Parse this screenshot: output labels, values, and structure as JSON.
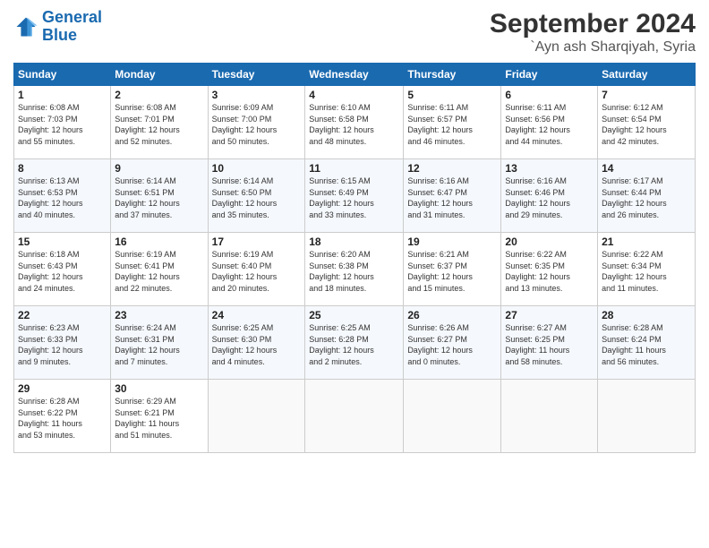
{
  "logo": {
    "line1": "General",
    "line2": "Blue"
  },
  "title": "September 2024",
  "subtitle": "`Ayn ash Sharqiyah, Syria",
  "header_days": [
    "Sunday",
    "Monday",
    "Tuesday",
    "Wednesday",
    "Thursday",
    "Friday",
    "Saturday"
  ],
  "weeks": [
    [
      {
        "day": "1",
        "info": "Sunrise: 6:08 AM\nSunset: 7:03 PM\nDaylight: 12 hours\nand 55 minutes."
      },
      {
        "day": "2",
        "info": "Sunrise: 6:08 AM\nSunset: 7:01 PM\nDaylight: 12 hours\nand 52 minutes."
      },
      {
        "day": "3",
        "info": "Sunrise: 6:09 AM\nSunset: 7:00 PM\nDaylight: 12 hours\nand 50 minutes."
      },
      {
        "day": "4",
        "info": "Sunrise: 6:10 AM\nSunset: 6:58 PM\nDaylight: 12 hours\nand 48 minutes."
      },
      {
        "day": "5",
        "info": "Sunrise: 6:11 AM\nSunset: 6:57 PM\nDaylight: 12 hours\nand 46 minutes."
      },
      {
        "day": "6",
        "info": "Sunrise: 6:11 AM\nSunset: 6:56 PM\nDaylight: 12 hours\nand 44 minutes."
      },
      {
        "day": "7",
        "info": "Sunrise: 6:12 AM\nSunset: 6:54 PM\nDaylight: 12 hours\nand 42 minutes."
      }
    ],
    [
      {
        "day": "8",
        "info": "Sunrise: 6:13 AM\nSunset: 6:53 PM\nDaylight: 12 hours\nand 40 minutes."
      },
      {
        "day": "9",
        "info": "Sunrise: 6:14 AM\nSunset: 6:51 PM\nDaylight: 12 hours\nand 37 minutes."
      },
      {
        "day": "10",
        "info": "Sunrise: 6:14 AM\nSunset: 6:50 PM\nDaylight: 12 hours\nand 35 minutes."
      },
      {
        "day": "11",
        "info": "Sunrise: 6:15 AM\nSunset: 6:49 PM\nDaylight: 12 hours\nand 33 minutes."
      },
      {
        "day": "12",
        "info": "Sunrise: 6:16 AM\nSunset: 6:47 PM\nDaylight: 12 hours\nand 31 minutes."
      },
      {
        "day": "13",
        "info": "Sunrise: 6:16 AM\nSunset: 6:46 PM\nDaylight: 12 hours\nand 29 minutes."
      },
      {
        "day": "14",
        "info": "Sunrise: 6:17 AM\nSunset: 6:44 PM\nDaylight: 12 hours\nand 26 minutes."
      }
    ],
    [
      {
        "day": "15",
        "info": "Sunrise: 6:18 AM\nSunset: 6:43 PM\nDaylight: 12 hours\nand 24 minutes."
      },
      {
        "day": "16",
        "info": "Sunrise: 6:19 AM\nSunset: 6:41 PM\nDaylight: 12 hours\nand 22 minutes."
      },
      {
        "day": "17",
        "info": "Sunrise: 6:19 AM\nSunset: 6:40 PM\nDaylight: 12 hours\nand 20 minutes."
      },
      {
        "day": "18",
        "info": "Sunrise: 6:20 AM\nSunset: 6:38 PM\nDaylight: 12 hours\nand 18 minutes."
      },
      {
        "day": "19",
        "info": "Sunrise: 6:21 AM\nSunset: 6:37 PM\nDaylight: 12 hours\nand 15 minutes."
      },
      {
        "day": "20",
        "info": "Sunrise: 6:22 AM\nSunset: 6:35 PM\nDaylight: 12 hours\nand 13 minutes."
      },
      {
        "day": "21",
        "info": "Sunrise: 6:22 AM\nSunset: 6:34 PM\nDaylight: 12 hours\nand 11 minutes."
      }
    ],
    [
      {
        "day": "22",
        "info": "Sunrise: 6:23 AM\nSunset: 6:33 PM\nDaylight: 12 hours\nand 9 minutes."
      },
      {
        "day": "23",
        "info": "Sunrise: 6:24 AM\nSunset: 6:31 PM\nDaylight: 12 hours\nand 7 minutes."
      },
      {
        "day": "24",
        "info": "Sunrise: 6:25 AM\nSunset: 6:30 PM\nDaylight: 12 hours\nand 4 minutes."
      },
      {
        "day": "25",
        "info": "Sunrise: 6:25 AM\nSunset: 6:28 PM\nDaylight: 12 hours\nand 2 minutes."
      },
      {
        "day": "26",
        "info": "Sunrise: 6:26 AM\nSunset: 6:27 PM\nDaylight: 12 hours\nand 0 minutes."
      },
      {
        "day": "27",
        "info": "Sunrise: 6:27 AM\nSunset: 6:25 PM\nDaylight: 11 hours\nand 58 minutes."
      },
      {
        "day": "28",
        "info": "Sunrise: 6:28 AM\nSunset: 6:24 PM\nDaylight: 11 hours\nand 56 minutes."
      }
    ],
    [
      {
        "day": "29",
        "info": "Sunrise: 6:28 AM\nSunset: 6:22 PM\nDaylight: 11 hours\nand 53 minutes."
      },
      {
        "day": "30",
        "info": "Sunrise: 6:29 AM\nSunset: 6:21 PM\nDaylight: 11 hours\nand 51 minutes."
      },
      {
        "day": "",
        "info": ""
      },
      {
        "day": "",
        "info": ""
      },
      {
        "day": "",
        "info": ""
      },
      {
        "day": "",
        "info": ""
      },
      {
        "day": "",
        "info": ""
      }
    ]
  ]
}
